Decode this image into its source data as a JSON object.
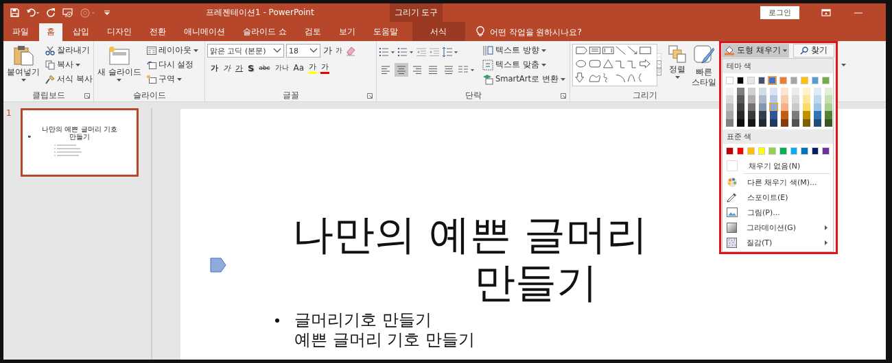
{
  "title_bar": {
    "title": "프레젠테이션1  -  PowerPoint",
    "context_group": "그리기 도구",
    "login": "로그인"
  },
  "tabs": [
    {
      "label": "파일",
      "selected": false,
      "kind": "normal"
    },
    {
      "label": "홈",
      "selected": true,
      "kind": "normal"
    },
    {
      "label": "삽입",
      "selected": false,
      "kind": "normal"
    },
    {
      "label": "디자인",
      "selected": false,
      "kind": "normal"
    },
    {
      "label": "전환",
      "selected": false,
      "kind": "normal"
    },
    {
      "label": "애니메이션",
      "selected": false,
      "kind": "normal"
    },
    {
      "label": "슬라이드 쇼",
      "selected": false,
      "kind": "normal"
    },
    {
      "label": "검토",
      "selected": false,
      "kind": "normal"
    },
    {
      "label": "보기",
      "selected": false,
      "kind": "normal"
    },
    {
      "label": "도움말",
      "selected": false,
      "kind": "normal"
    },
    {
      "label": "서식",
      "selected": false,
      "kind": "context"
    }
  ],
  "tell_me": "어떤 작업을 원하시나요?",
  "ribbon": {
    "clipboard": {
      "label": "클립보드",
      "paste": "붙여넣기",
      "cut": "잘라내기",
      "copy": "복사",
      "format_painter": "서식 복사"
    },
    "slides": {
      "label": "슬라이드",
      "new_slide": "새 슬라이드",
      "layout": "레이아웃",
      "reset": "다시 설정",
      "section": "구역"
    },
    "font": {
      "label": "글꼴",
      "font_name": "맑은 고딕 (본문)",
      "font_size": "18",
      "grow": "가",
      "shrink": "가",
      "format_buttons": [
        {
          "text": "가",
          "kind": "bold"
        },
        {
          "text": "가",
          "kind": "italic"
        },
        {
          "text": "가",
          "kind": "underline"
        },
        {
          "text": "S",
          "kind": "shadow"
        },
        {
          "text": "abc",
          "kind": "strike"
        },
        {
          "text": "가나",
          "kind": "spacing"
        },
        {
          "text": "Aa",
          "kind": "case"
        },
        {
          "text": "가",
          "kind": "highlight"
        },
        {
          "text": "가",
          "kind": "color"
        }
      ]
    },
    "paragraph": {
      "label": "단락",
      "text_direction": "텍스트 방향",
      "align_text": "텍스트 맞춤",
      "smartart": "SmartArt로 변환",
      "alignments": [
        {
          "kind": "left",
          "selected": false
        },
        {
          "kind": "center",
          "selected": true
        },
        {
          "kind": "right",
          "selected": false
        },
        {
          "kind": "justify",
          "selected": false
        },
        {
          "kind": "distributed",
          "selected": false
        }
      ]
    },
    "drawing": {
      "label": "그리기",
      "arrange": "정렬",
      "quick_styles": "빠른 스타일"
    }
  },
  "fill_menu": {
    "button": "도형 채우기",
    "find": "찾기",
    "theme_header": "테마 색",
    "theme_colors": [
      {
        "color": "#ffffff",
        "selected": false,
        "shades": [
          {
            "color": "#f2f2f2",
            "selected": false
          },
          {
            "color": "#d9d9d9",
            "selected": false
          },
          {
            "color": "#bfbfbf",
            "selected": false
          },
          {
            "color": "#a6a6a6",
            "selected": false
          },
          {
            "color": "#808080",
            "selected": false
          }
        ]
      },
      {
        "color": "#000000",
        "selected": false,
        "shades": [
          {
            "color": "#7f7f7f",
            "selected": false
          },
          {
            "color": "#595959",
            "selected": false
          },
          {
            "color": "#404040",
            "selected": false
          },
          {
            "color": "#262626",
            "selected": false
          },
          {
            "color": "#0d0d0d",
            "selected": false
          }
        ]
      },
      {
        "color": "#e7e6e6",
        "selected": false,
        "shades": [
          {
            "color": "#d0cece",
            "selected": false
          },
          {
            "color": "#afabab",
            "selected": false
          },
          {
            "color": "#767171",
            "selected": false
          },
          {
            "color": "#3b3838",
            "selected": false
          },
          {
            "color": "#181717",
            "selected": false
          }
        ]
      },
      {
        "color": "#44546a",
        "selected": false,
        "shades": [
          {
            "color": "#d6dce5",
            "selected": false
          },
          {
            "color": "#adb9ca",
            "selected": false
          },
          {
            "color": "#8497b0",
            "selected": false
          },
          {
            "color": "#333f50",
            "selected": false
          },
          {
            "color": "#222a35",
            "selected": false
          }
        ]
      },
      {
        "color": "#4472c4",
        "selected": true,
        "shades": [
          {
            "color": "#dae3f3",
            "selected": false
          },
          {
            "color": "#b4c7e7",
            "selected": false
          },
          {
            "color": "#8faadc",
            "selected": true
          },
          {
            "color": "#2f5597",
            "selected": false
          },
          {
            "color": "#203864",
            "selected": false
          }
        ]
      },
      {
        "color": "#ed7d31",
        "selected": false,
        "shades": [
          {
            "color": "#fbe5d6",
            "selected": false
          },
          {
            "color": "#f8cbad",
            "selected": false
          },
          {
            "color": "#f4b183",
            "selected": false
          },
          {
            "color": "#c55a11",
            "selected": false
          },
          {
            "color": "#843c0c",
            "selected": false
          }
        ]
      },
      {
        "color": "#a5a5a5",
        "selected": false,
        "shades": [
          {
            "color": "#ededed",
            "selected": false
          },
          {
            "color": "#dbdbdb",
            "selected": false
          },
          {
            "color": "#c9c9c9",
            "selected": false
          },
          {
            "color": "#7b7b7b",
            "selected": false
          },
          {
            "color": "#525252",
            "selected": false
          }
        ]
      },
      {
        "color": "#ffc000",
        "selected": false,
        "shades": [
          {
            "color": "#fff2cc",
            "selected": false
          },
          {
            "color": "#ffe699",
            "selected": false
          },
          {
            "color": "#ffd966",
            "selected": false
          },
          {
            "color": "#bf9000",
            "selected": false
          },
          {
            "color": "#7f6000",
            "selected": false
          }
        ]
      },
      {
        "color": "#5b9bd5",
        "selected": false,
        "shades": [
          {
            "color": "#deebf7",
            "selected": false
          },
          {
            "color": "#bdd7ee",
            "selected": false
          },
          {
            "color": "#9dc3e6",
            "selected": false
          },
          {
            "color": "#2e75b6",
            "selected": false
          },
          {
            "color": "#1f4e79",
            "selected": false
          }
        ]
      },
      {
        "color": "#70ad47",
        "selected": false,
        "shades": [
          {
            "color": "#e2f0d9",
            "selected": false
          },
          {
            "color": "#c5e0b4",
            "selected": false
          },
          {
            "color": "#a9d18e",
            "selected": false
          },
          {
            "color": "#548235",
            "selected": false
          },
          {
            "color": "#385723",
            "selected": false
          }
        ]
      }
    ],
    "standard_header": "표준 색",
    "standard_colors": [
      {
        "color": "#c00000",
        "selected": false
      },
      {
        "color": "#ff0000",
        "selected": false
      },
      {
        "color": "#ffc000",
        "selected": false
      },
      {
        "color": "#ffff00",
        "selected": false
      },
      {
        "color": "#92d050",
        "selected": false
      },
      {
        "color": "#00b050",
        "selected": false
      },
      {
        "color": "#00b0f0",
        "selected": false
      },
      {
        "color": "#0070c0",
        "selected": false
      },
      {
        "color": "#002060",
        "selected": false
      },
      {
        "color": "#7030a0",
        "selected": false
      }
    ],
    "no_fill": "채우기 없음(N)",
    "items": [
      {
        "label": "다른 채우기 색(M)...",
        "kind": "more_colors",
        "submenu": false
      },
      {
        "label": "스포이트(E)",
        "kind": "eyedropper",
        "submenu": false
      },
      {
        "label": "그림(P)...",
        "kind": "picture",
        "submenu": false
      },
      {
        "label": "그라데이션(G)",
        "kind": "gradient",
        "submenu": true
      },
      {
        "label": "질감(T)",
        "kind": "texture",
        "submenu": true
      }
    ]
  },
  "thumbnails": [
    {
      "number": "1",
      "selected": true,
      "title": "나만의 예쁜 글머리 기호 만들기"
    }
  ],
  "slide": {
    "title_lines": [
      "나만의 예쁜 글머리",
      "만들기"
    ],
    "bullets": [
      "글머리기호 만들기",
      "예쁜 글머리 기호 만들기"
    ]
  }
}
